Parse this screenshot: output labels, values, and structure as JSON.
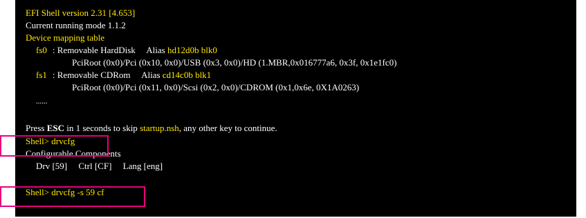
{
  "colors": {
    "background": "#000000",
    "text": "#ffffff",
    "highlight_text": "#ffe600",
    "annotation_box": "#e8007f"
  },
  "lines": {
    "version": "EFI Shell version 2.31 [4.653]",
    "mode": "Current running mode 1.1.2",
    "mapping_header": "Device mapping table",
    "fs0_name": "fs0",
    "fs0_desc": ": Removable HardDisk     Alias ",
    "fs0_alias": "hd12d0b blk0",
    "fs0_path": "PciRoot (0x0)/Pci (0x10, 0x0)/USB (0x3, 0x0)/HD (1.MBR,0x016777a6, 0x3f, 0x1e1fc0)",
    "fs1_name": "fs1",
    "fs1_desc": ": Removable CDRom     Alias ",
    "fs1_alias": "cd14c0b blk1",
    "fs1_path": "PciRoot (0x0)/Pci (0x11, 0x0)/Scsi (0x2, 0x0)/CDROM (0x1,0x6e, 0X1A0263)",
    "ellipsis": "......",
    "press_pre": "Press ",
    "press_key": "ESC",
    "press_mid": " in 1 seconds to skip ",
    "press_file": "startup.nsh",
    "press_post": ", any other key to continue.",
    "cmd1": "Shell> drvcfg",
    "configurable": "Configurable Components",
    "drv_line": "Drv [59]     Ctrl [CF]     Lang [eng]",
    "cmd2": "Shell> drvcfg -s 59 cf"
  }
}
